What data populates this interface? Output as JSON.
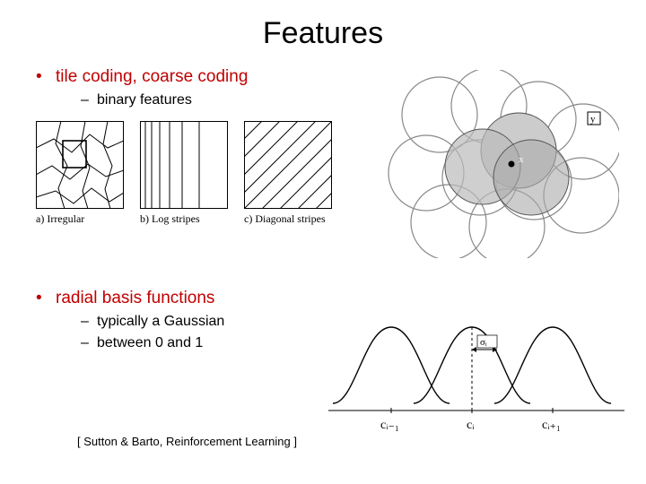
{
  "title": "Features",
  "bullets": {
    "b1": "tile coding, coarse coding",
    "b1a": "binary features",
    "b2": "radial basis functions",
    "b2a": "typically a Gaussian",
    "b2b": "between 0 and 1"
  },
  "tile_captions": {
    "a": "a) Irregular",
    "b": "b) Log stripes",
    "c": "c) Diagonal stripes"
  },
  "circles": {
    "x_label": "x",
    "y_label": "y"
  },
  "gauss": {
    "sigma": "σᵢ",
    "ticks": {
      "left": "cᵢ₋₁",
      "mid": "cᵢ",
      "right": "cᵢ₊₁"
    }
  },
  "citation": "[ Sutton & Barto, Reinforcement Learning ]"
}
